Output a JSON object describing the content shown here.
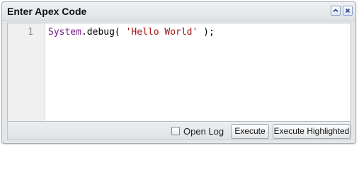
{
  "panel": {
    "title": "Enter Apex Code",
    "tools": {
      "collapse_icon": "chevron-up-icon",
      "close_icon": "close-icon"
    }
  },
  "editor": {
    "line_numbers": [
      "1"
    ],
    "code_tokens": [
      {
        "text": "System",
        "kind": "class"
      },
      {
        "text": ".debug( ",
        "kind": "plain"
      },
      {
        "text": "'Hello World'",
        "kind": "string"
      },
      {
        "text": " );",
        "kind": "plain"
      }
    ],
    "colors": {
      "class": "#7a1f8a",
      "string": "#a31515",
      "plain": "#000000"
    }
  },
  "footer": {
    "open_log_label": "Open Log",
    "open_log_checked": false,
    "execute_label": "Execute",
    "execute_highlighted_label": "Execute Highlighted"
  }
}
